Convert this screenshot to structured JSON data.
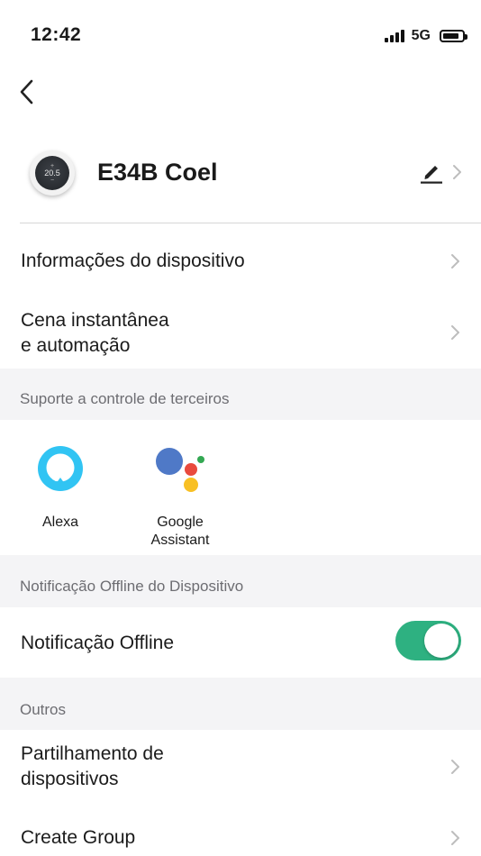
{
  "status_bar": {
    "time": "12:42",
    "network": "5G"
  },
  "device": {
    "name": "E34B Coel",
    "thumbnail_reading": "20.5"
  },
  "menu": {
    "device_info": "Informações do dispositivo",
    "scene_line1": "Cena instantânea",
    "scene_line2": "e automação"
  },
  "third_party": {
    "section_title": "Suporte a controle de terceiros",
    "items": [
      {
        "name_line1": "Alexa",
        "name_line2": "",
        "icon": "alexa-icon"
      },
      {
        "name_line1": "Google",
        "name_line2": "Assistant",
        "icon": "google-assistant-icon"
      }
    ]
  },
  "offline": {
    "section_title": "Notificação Offline do Dispositivo",
    "label": "Notificação Offline",
    "enabled": true
  },
  "others": {
    "section_title": "Outros",
    "share_line1": "Partilhamento de",
    "share_line2": "dispositivos",
    "create_group": "Create Group"
  },
  "colors": {
    "toggle_on": "#2eb181",
    "alexa": "#31c4f3",
    "google_blue": "#4f79c7",
    "google_red": "#e94a3d",
    "google_yellow": "#f8c024",
    "google_green": "#33a853",
    "section_bg": "#f4f4f6"
  }
}
